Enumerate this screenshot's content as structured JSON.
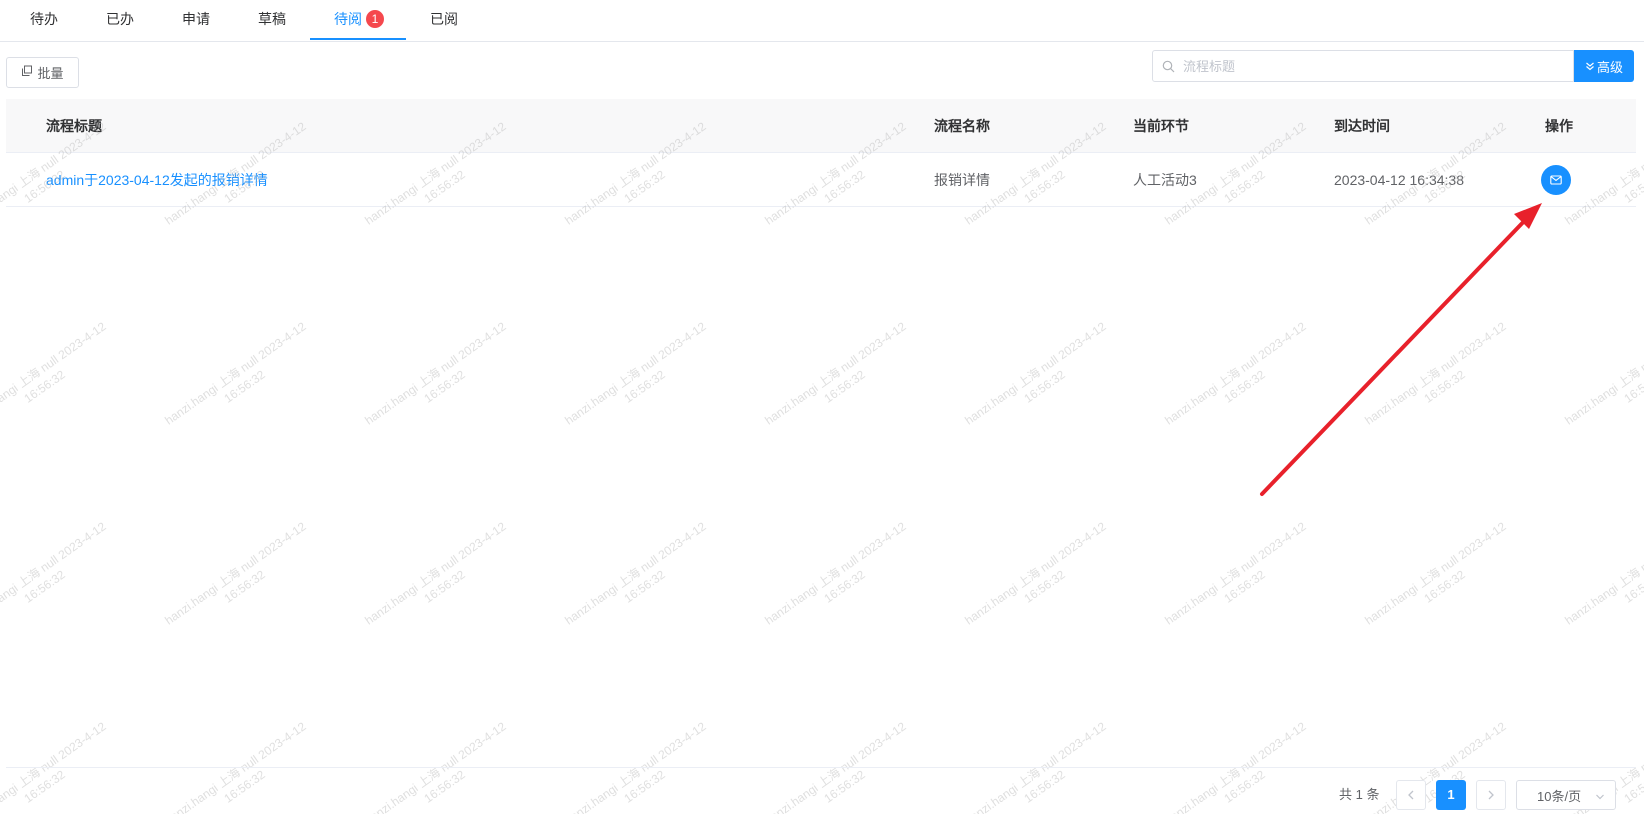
{
  "tabs": [
    {
      "label": "待办"
    },
    {
      "label": "已办"
    },
    {
      "label": "申请"
    },
    {
      "label": "草稿"
    },
    {
      "label": "待阅",
      "badge": "1",
      "active": true
    },
    {
      "label": "已阅"
    }
  ],
  "toolbar": {
    "batch_label": "批量",
    "search_placeholder": "流程标题",
    "advanced_label": "高级"
  },
  "table": {
    "columns": [
      "流程标题",
      "流程名称",
      "当前环节",
      "到达时间",
      "操作"
    ],
    "rows": [
      {
        "title": "admin于2023-04-12发起的报销详情",
        "process_name": "报销详情",
        "current_step": "人工活动3",
        "arrival_time": "2023-04-12 16:34:38",
        "action_icon": "mail-icon"
      }
    ]
  },
  "watermark": {
    "line1": "hanzi.hangi 上海 null 2023-4-12",
    "line2": "16:56:32"
  },
  "pagination": {
    "total_label": "共 1 条",
    "current_page": "1",
    "page_size_label": "10条/页"
  },
  "colors": {
    "accent": "#1890ff",
    "badge": "#f5484d",
    "annotation_arrow": "#e8212b"
  }
}
